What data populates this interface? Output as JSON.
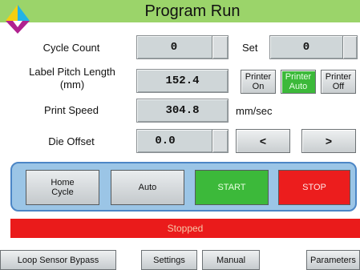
{
  "header": {
    "title": "Program Run",
    "bar_color": "#9bd46a"
  },
  "fields": {
    "cycle_count": {
      "label": "Cycle Count",
      "value": "0"
    },
    "set": {
      "label": "Set",
      "value": "0"
    },
    "label_pitch": {
      "label_line1": "Label Pitch Length",
      "label_line2": "(mm)",
      "value": "152.4"
    },
    "print_speed": {
      "label": "Print Speed",
      "value": "304.8",
      "unit": "mm/sec"
    },
    "die_offset": {
      "label": "Die Offset",
      "value": "0.0"
    }
  },
  "printer_buttons": [
    {
      "line1": "Printer",
      "line2": "On",
      "active": false
    },
    {
      "line1": "Printer",
      "line2": "Auto",
      "active": true
    },
    {
      "line1": "Printer",
      "line2": "Off",
      "active": false
    }
  ],
  "arrows": {
    "left": "<",
    "right": ">"
  },
  "control_panel": {
    "home_line1": "Home",
    "home_line2": "Cycle",
    "auto": "Auto",
    "start": "START",
    "stop": "STOP"
  },
  "status": {
    "text": "Stopped",
    "color": "#ea1b1b"
  },
  "bottom_bar": {
    "loop_sensor": "Loop Sensor Bypass",
    "settings": "Settings",
    "manual": "Manual",
    "parameters": "Parameters"
  },
  "colors": {
    "start": "#3cb93a",
    "stop": "#ec1d1d",
    "panel": "#9bc5e6",
    "printer_active": "#3cb93a"
  },
  "icons": {
    "logo": "tricolor-logo-icon"
  }
}
